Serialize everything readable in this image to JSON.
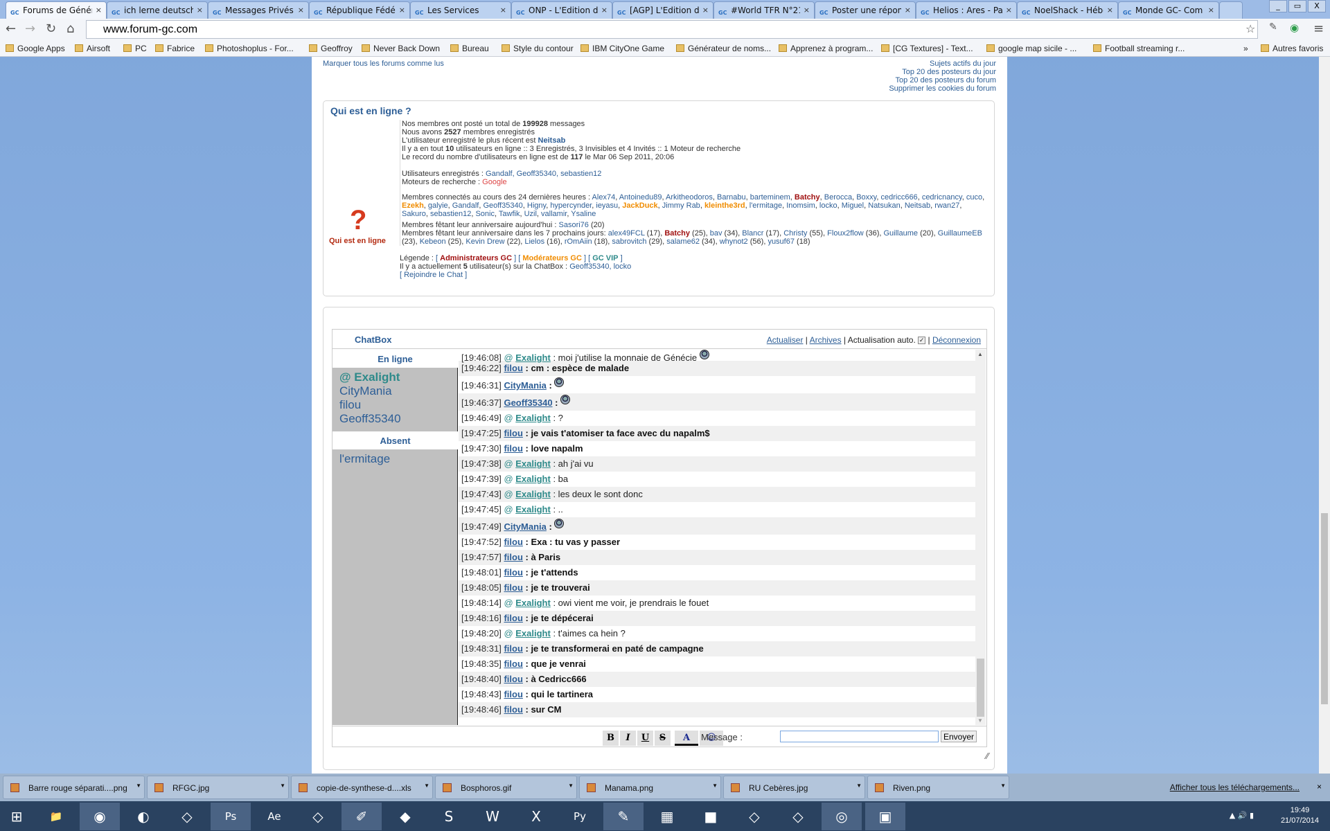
{
  "browser": {
    "tabs": [
      "Forums de Génér",
      "ich lerne deutsch",
      "Messages Privés",
      "République Fédér",
      "Les Services",
      "ONP - L'Edition d",
      "[AGP] L'Edition d",
      "#World TFR N°21",
      "Poster une répon",
      "Helios : Ares - Pa",
      "NoelShack - Hébe",
      "Monde GC- Com"
    ],
    "url": "www.forum-gc.com",
    "bookmarks": [
      "Google Apps",
      "Airsoft",
      "PC",
      "Fabrice",
      "Photoshoplus - For...",
      "Geoffroy",
      "Never Back Down",
      "Bureau",
      "Style du contour",
      "IBM CityOne Game",
      "Générateur de noms...",
      "Apprenez à program...",
      "[CG Textures] - Text...",
      "google map sicile - ...",
      "Football streaming r...",
      "»",
      "Autres favoris"
    ]
  },
  "top_links": {
    "mark_read": "Marquer tous les forums comme lus",
    "right": [
      "Sujets actifs du jour",
      "Top 20 des posteurs du jour",
      "Top 20 des posteurs du forum",
      "Supprimer les cookies du forum"
    ]
  },
  "who": {
    "title": "Qui est en ligne ?",
    "icon_label": "Qui est en ligne",
    "l1a": "Nos membres ont posté un total de ",
    "total_posts": "199928",
    "l1b": " messages",
    "l2a": "Nous avons ",
    "members": "2527",
    "l2b": " membres enregistrés",
    "l3a": "L'utilisateur enregistré le plus récent est ",
    "newest": "Neitsab",
    "l4a": "Il y a en tout ",
    "online": "10",
    "l4b": " utilisateurs en ligne :: 3 Enregistrés, 3 Invisibles et 4 Invités :: 1 Moteur de recherche",
    "l5a": "Le record du nombre d'utilisateurs en ligne est de ",
    "record": "117",
    "l5b": " le Mar 06 Sep 2011, 20:06",
    "reg_label": "Utilisateurs enregistrés : ",
    "reg_users": "Gandalf, Geoff35340, sebastien12",
    "bots_label": "Moteurs de recherche : ",
    "bots": "Google",
    "last24_label": "Membres connectés au cours des 24 dernières heures : ",
    "last24": [
      [
        "Alex74",
        "u"
      ],
      [
        "Antoinedu89",
        "u"
      ],
      [
        "Arkitheodoros",
        "u"
      ],
      [
        "Barnabu",
        "u"
      ],
      [
        "barteminem",
        "u"
      ],
      [
        "Batchy",
        "adm"
      ],
      [
        "Berocca",
        "u"
      ],
      [
        "Boxxy",
        "u"
      ],
      [
        "cedricc666",
        "u"
      ],
      [
        "cedricnancy",
        "u"
      ],
      [
        "cuco",
        "u"
      ],
      [
        "Ezekh",
        "mod"
      ],
      [
        "galyie",
        "u"
      ],
      [
        "Gandalf",
        "u"
      ],
      [
        "Geoff35340",
        "u"
      ],
      [
        "Higny",
        "u"
      ],
      [
        "hypercynder",
        "u"
      ],
      [
        "ieyasu",
        "u"
      ],
      [
        "JackDuck",
        "mod"
      ],
      [
        "Jimmy Rab",
        "u"
      ],
      [
        "kleinthe3rd",
        "mod"
      ],
      [
        "l'ermitage",
        "u"
      ],
      [
        "Inomsim",
        "u"
      ],
      [
        "locko",
        "u"
      ],
      [
        "Miguel",
        "u"
      ],
      [
        "Natsukan",
        "u"
      ],
      [
        "Neitsab",
        "u"
      ],
      [
        "rwan27",
        "u"
      ],
      [
        "Sakuro",
        "u"
      ],
      [
        "sebastien12",
        "u"
      ],
      [
        "Sonic",
        "u"
      ],
      [
        "Tawfik",
        "u"
      ],
      [
        "Uzil",
        "u"
      ],
      [
        "vallamir",
        "u"
      ],
      [
        "Ysaline",
        "u"
      ]
    ],
    "bday_today_label": "Membres fêtant leur anniversaire aujourd'hui : ",
    "bday_today": [
      [
        "Sasori76",
        "u",
        " (20)"
      ]
    ],
    "bday_week_label": "Membres fêtant leur anniversaire dans les 7 prochains jours: ",
    "bday_week": [
      [
        "alex49FCL",
        "u",
        " (17)"
      ],
      [
        "Batchy",
        "adm",
        " (25)"
      ],
      [
        "bav",
        "u",
        " (34)"
      ],
      [
        "Blancr",
        "u",
        " (17)"
      ],
      [
        "Christy",
        "u",
        " (55)"
      ],
      [
        "Floux2flow",
        "u",
        " (36)"
      ],
      [
        "Guillaume",
        "u",
        " (20)"
      ],
      [
        "GuillaumeEB",
        "u",
        " (23)"
      ],
      [
        "Kebeon",
        "u",
        " (25)"
      ],
      [
        "Kevin Drew",
        "u",
        " (22)"
      ],
      [
        "Lielos",
        "u",
        " (16)"
      ],
      [
        "rOmAiin",
        "u",
        " (18)"
      ],
      [
        "sabrovitch",
        "u",
        " (29)"
      ],
      [
        "salame62",
        "u",
        " (34)"
      ],
      [
        "whynot2",
        "u",
        " (56)"
      ],
      [
        "yusuf67",
        "u",
        " (18)"
      ]
    ],
    "legend_label": "Légende : ",
    "legend": [
      "Administrateurs GC",
      "Modérateurs GC",
      "GC VIP"
    ],
    "chat_users_a": "Il y a actuellement ",
    "chat_users_n": "5",
    "chat_users_b": " utilisateur(s) sur la ChatBox : ",
    "chat_users": "Geoff35340, locko",
    "join": "[ Rejoindre le Chat ]"
  },
  "role_colors": {
    "admin": "#a01010",
    "moderator": "#f08c00",
    "vip": "#2e8a8a",
    "member": "#2d5e96"
  },
  "chatbox": {
    "title": "ChatBox",
    "refresh": "Actualiser",
    "archives": "Archives",
    "auto_label": "Actualisation auto.",
    "auto_checked": true,
    "logout": "Déconnexion",
    "online_header": "En ligne",
    "online": [
      "@ Exalight",
      "CityMania",
      "filou",
      "Geoff35340"
    ],
    "away_header": "Absent",
    "away": [
      "l'ermitage"
    ],
    "messages": [
      {
        "time": "[19:46:08]",
        "user": "Exalight",
        "vip": true,
        "text": " : moi j'utilise la monnaie de Génécie ",
        "smiley": true
      },
      {
        "time": "[19:46:22]",
        "user": "filou",
        "text": " : cm : espèce de malade",
        "bold": true
      },
      {
        "time": "[19:46:31]",
        "user": "CityMania",
        "text": " : ",
        "bold": true,
        "smiley": true
      },
      {
        "time": "[19:46:37]",
        "user": "Geoff35340",
        "text": " : ",
        "bold": true,
        "smiley": true
      },
      {
        "time": "[19:46:49]",
        "user": "Exalight",
        "vip": true,
        "text": " : ?"
      },
      {
        "time": "[19:47:25]",
        "user": "filou",
        "text": " : je vais t'atomiser ta face avec du napalm$",
        "bold": true
      },
      {
        "time": "[19:47:30]",
        "user": "filou",
        "text": " : love napalm",
        "bold": true
      },
      {
        "time": "[19:47:38]",
        "user": "Exalight",
        "vip": true,
        "text": " : ah j'ai vu"
      },
      {
        "time": "[19:47:39]",
        "user": "Exalight",
        "vip": true,
        "text": " : ba"
      },
      {
        "time": "[19:47:43]",
        "user": "Exalight",
        "vip": true,
        "text": " : les deux le sont donc"
      },
      {
        "time": "[19:47:45]",
        "user": "Exalight",
        "vip": true,
        "text": " : .."
      },
      {
        "time": "[19:47:49]",
        "user": "CityMania",
        "text": " : ",
        "bold": true,
        "smiley": true
      },
      {
        "time": "[19:47:52]",
        "user": "filou",
        "text": " : Exa : tu vas y passer",
        "bold": true
      },
      {
        "time": "[19:47:57]",
        "user": "filou",
        "text": " : à Paris",
        "bold": true
      },
      {
        "time": "[19:48:01]",
        "user": "filou",
        "text": " : je t'attends",
        "bold": true
      },
      {
        "time": "[19:48:05]",
        "user": "filou",
        "text": " : je te trouverai",
        "bold": true
      },
      {
        "time": "[19:48:14]",
        "user": "Exalight",
        "vip": true,
        "text": " : owi vient me voir, je prendrais le fouet"
      },
      {
        "time": "[19:48:16]",
        "user": "filou",
        "text": " : je te dépécerai",
        "bold": true
      },
      {
        "time": "[19:48:20]",
        "user": "Exalight",
        "vip": true,
        "text": " : t'aimes ca hein ?"
      },
      {
        "time": "[19:48:31]",
        "user": "filou",
        "text": " : je te transformerai en paté de campagne",
        "bold": true
      },
      {
        "time": "[19:48:35]",
        "user": "filou",
        "text": " : que je venrai",
        "bold": true
      },
      {
        "time": "[19:48:40]",
        "user": "filou",
        "text": " : à Cedricc666",
        "bold": true
      },
      {
        "time": "[19:48:43]",
        "user": "filou",
        "text": " : qui le tartinera",
        "bold": true
      },
      {
        "time": "[19:48:46]",
        "user": "filou",
        "text": " : sur CM",
        "bold": true
      }
    ],
    "format": {
      "bold": "B",
      "italic": "I",
      "underline": "U",
      "strike": "S",
      "color": "A",
      "smiley": "☺"
    },
    "message_label": "Message :",
    "message_value": "",
    "send": "Envoyer"
  },
  "downloads": {
    "items": [
      "Barre rouge séparati....png",
      "RFGC.jpg",
      "copie-de-synthese-d....xls",
      "Bosphoros.gif",
      "Manama.png",
      "RU Cebères.jpg",
      "Riven.png"
    ],
    "show_all": "Afficher tous les téléchargements...",
    "close": "×"
  },
  "taskbar": {
    "apps": [
      "start",
      "file-explorer",
      "chrome",
      "firefox",
      "app",
      "photoshop",
      "after-effects",
      "app",
      "paint",
      "inkscape",
      "skype",
      "word",
      "excel",
      "python",
      "notepad",
      "calculator",
      "minecraft",
      "app",
      "app",
      "origin",
      "photos"
    ],
    "time": "19:49",
    "date": "21/07/2014"
  }
}
